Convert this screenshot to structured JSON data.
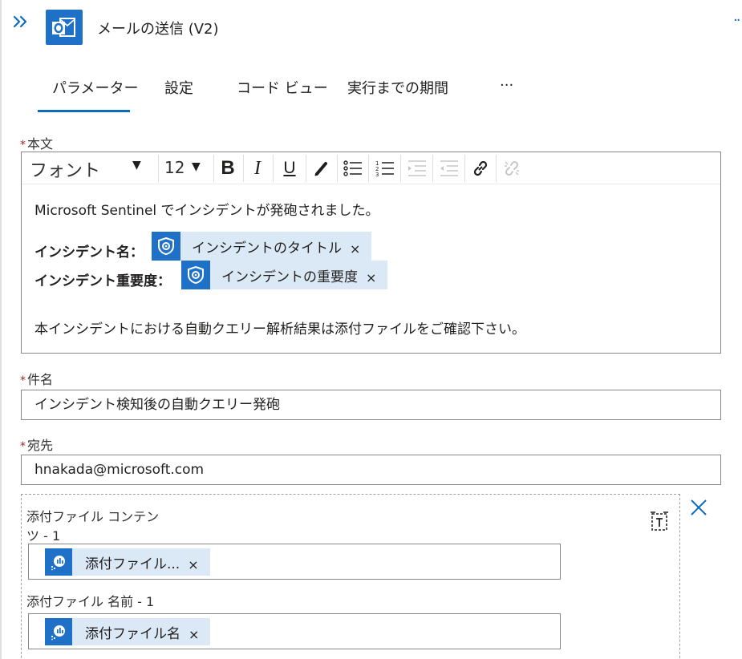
{
  "header": {
    "title": "メールの送信 (V2)",
    "more_label": "..",
    "app_icon": "outlook-icon",
    "collapse_icon": "double-chevron-right-icon"
  },
  "tabs": [
    {
      "label": "パラメーター",
      "active": true
    },
    {
      "label": "設定",
      "active": false
    },
    {
      "label": "コード ビュー",
      "active": false
    },
    {
      "label": "実行までの期間",
      "active": false
    },
    {
      "label": "···",
      "active": false
    }
  ],
  "body_field": {
    "label": "本文",
    "required_mark": "*",
    "toolbar": {
      "font": "フォント",
      "size": "12",
      "buttons": [
        "bold-icon",
        "italic-icon",
        "underline-icon",
        "font-color-icon",
        "bullet-list-icon",
        "numbered-list-icon",
        "indent-decrease-icon",
        "indent-increase-icon",
        "link-icon",
        "unlink-icon"
      ]
    },
    "content": {
      "line1": "Microsoft Sentinel でインシデントが発砲されました。",
      "incident_name_label": "インシデント名：",
      "incident_name_token": "インシデントのタイトル",
      "incident_severity_label": "インシデント重要度：",
      "incident_severity_token": "インシデントの重要度",
      "line_last": "本インシデントにおける自動クエリー解析結果は添付ファイルをご確認下さい。"
    },
    "token_close": "×"
  },
  "subject_field": {
    "label": "件名",
    "required_mark": "*",
    "value": "インシデント検知後の自動クエリー発砲"
  },
  "to_field": {
    "label": "宛先",
    "required_mark": "*",
    "value": "hnakada@microsoft.com"
  },
  "attachment": {
    "content_label_line1": "添付ファイル コンテン",
    "content_label_line2": "ツ - 1",
    "content_token": "添付ファイル...",
    "name_label": "添付ファイル 名前 - 1",
    "name_token": "添付ファイル名",
    "token_close": "×"
  },
  "colors": {
    "accent": "#0f6cbd",
    "token_bg": "#dbe9f6",
    "icon_bg": "#1f71c8",
    "required": "#a4262c"
  }
}
